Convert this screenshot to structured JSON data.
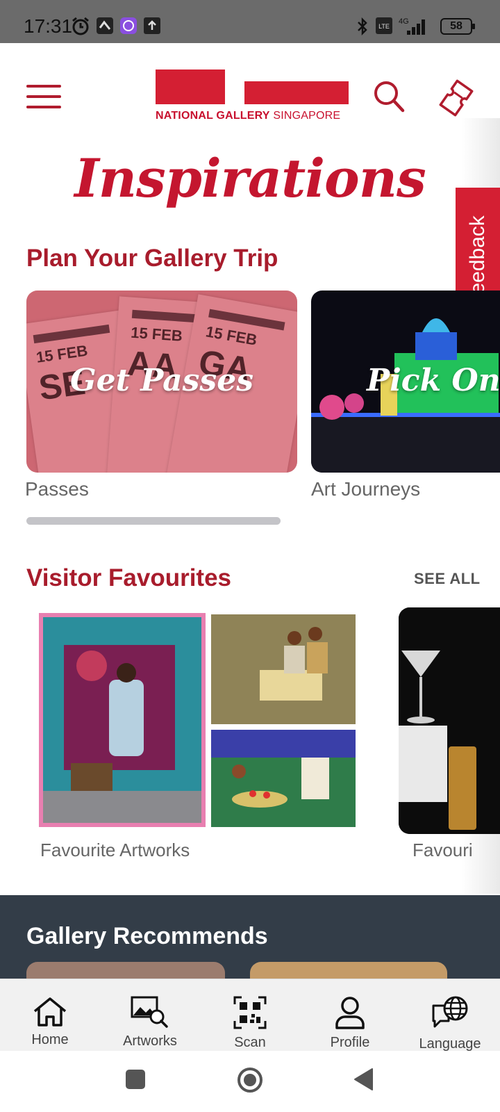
{
  "status_bar": {
    "time": "17:31",
    "battery": "58",
    "network": "4G"
  },
  "header": {
    "logo_text_bold": "NATIONAL GALLERY",
    "logo_text_light": "SINGAPORE",
    "menu_icon": "hamburger-menu-icon",
    "search_icon": "search-icon",
    "ticket_icon": "ticket-icon"
  },
  "hero": {
    "title": "Inspirations"
  },
  "feedback": {
    "label": "Feedback"
  },
  "plan_trip": {
    "heading": "Plan Your Gallery Trip",
    "cards": [
      {
        "title": "Get Passes",
        "label": "Passes",
        "tickets": [
          {
            "date": "15 FEB",
            "code": "SE"
          },
          {
            "date": "15 FEB",
            "code": "AA"
          },
          {
            "date": "15 FEB",
            "code": "GA"
          }
        ]
      },
      {
        "title": "Pick One",
        "label": "Art Journeys"
      }
    ]
  },
  "visitor_favourites": {
    "heading": "Visitor Favourites",
    "see_all": "SEE ALL",
    "cards": [
      {
        "label": "Favourite Artworks"
      },
      {
        "label": "Favouri"
      }
    ]
  },
  "gallery_recommends": {
    "heading": "Gallery Recommends"
  },
  "bottom_nav": {
    "items": [
      {
        "label": "Home",
        "icon": "home-icon"
      },
      {
        "label": "Artworks",
        "icon": "artworks-icon"
      },
      {
        "label": "Scan",
        "icon": "qr-scan-icon"
      },
      {
        "label": "Profile",
        "icon": "profile-icon"
      },
      {
        "label": "Language",
        "icon": "language-globe-icon"
      }
    ]
  },
  "colors": {
    "brand_red": "#d41f33",
    "heading_red": "#a81c2c",
    "dark_section": "#333d48"
  }
}
